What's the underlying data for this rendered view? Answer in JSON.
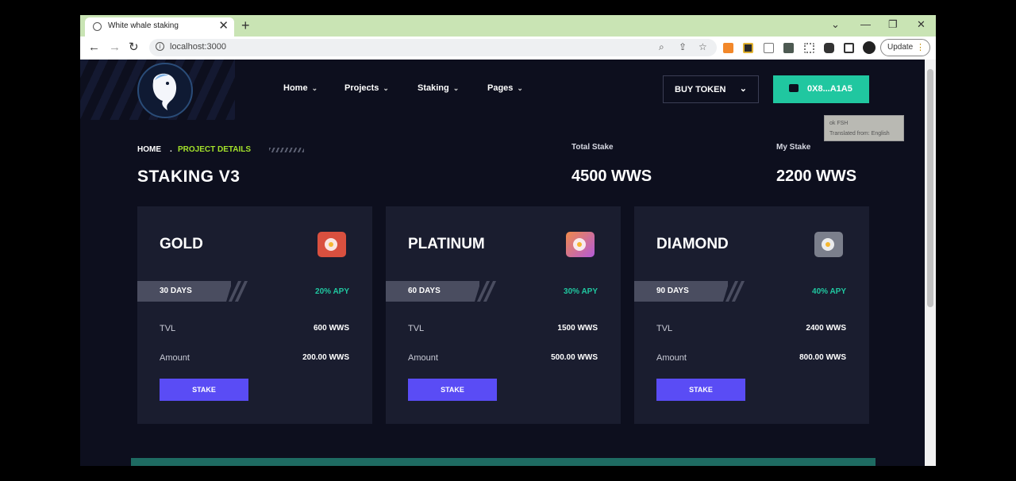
{
  "browser": {
    "tab_title": "White whale staking",
    "tab_close": "✕",
    "new_tab": "+",
    "url": "localhost:3000",
    "update_label": "Update",
    "window_controls": [
      "⌄",
      "—",
      "❐",
      "✕"
    ]
  },
  "header": {
    "nav": [
      {
        "label": "Home"
      },
      {
        "label": "Projects"
      },
      {
        "label": "Staking"
      },
      {
        "label": "Pages"
      }
    ],
    "buy_token_label": "BUY TOKEN",
    "wallet_label": "0X8...A1A5",
    "tooltip_line1": "ok FSH",
    "tooltip_line2": "Translated from: English"
  },
  "breadcrumb": {
    "home": "HOME",
    "separator": ".",
    "current": "PROJECT DETAILS"
  },
  "page_title": "STAKING V3",
  "stats": {
    "total_stake_label": "Total Stake",
    "total_stake_value": "4500 WWS",
    "my_stake_label": "My Stake",
    "my_stake_value": "2200 WWS"
  },
  "cards": [
    {
      "name": "GOLD",
      "days": "30 DAYS",
      "apy": "20% APY",
      "tvl_label": "TVL",
      "tvl": "600 WWS",
      "amount_label": "Amount",
      "amount": "200.00 WWS",
      "stake_label": "STAKE"
    },
    {
      "name": "PLATINUM",
      "days": "60 DAYS",
      "apy": "30% APY",
      "tvl_label": "TVL",
      "tvl": "1500 WWS",
      "amount_label": "Amount",
      "amount": "500.00 WWS",
      "stake_label": "STAKE"
    },
    {
      "name": "DIAMOND",
      "days": "90 DAYS",
      "apy": "40% APY",
      "tvl_label": "TVL",
      "tvl": "2400 WWS",
      "amount_label": "Amount",
      "amount": "800.00 WWS",
      "stake_label": "STAKE"
    }
  ],
  "colors": {
    "page_bg": "#0d0f1e",
    "card_bg": "#1a1d2f",
    "accent_teal": "#20c7a0",
    "accent_lime": "#a4e22b",
    "stake_button": "#5a4cf5",
    "gold_safe": "#d9503f",
    "platinum_safe": "#b35ad8",
    "diamond_safe": "#7b7f8c"
  },
  "icons": {
    "card_icons": [
      "safe-red-icon",
      "safe-purple-icon",
      "safe-grey-icon"
    ]
  }
}
